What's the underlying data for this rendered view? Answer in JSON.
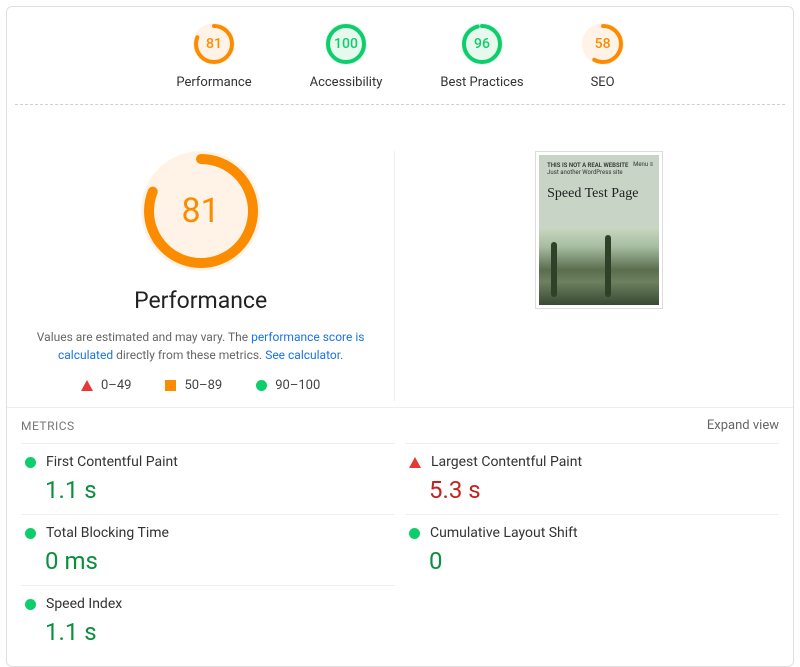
{
  "colors": {
    "avg": "#fb8c00",
    "good": "#0cce6b",
    "bad": "#e53935",
    "avg_fill": "#fef3e6",
    "good_fill": "#e7f8ed"
  },
  "top": [
    {
      "score": 81,
      "label": "Performance",
      "status": "avg"
    },
    {
      "score": 100,
      "label": "Accessibility",
      "status": "good"
    },
    {
      "score": 96,
      "label": "Best Practices",
      "status": "good"
    },
    {
      "score": 58,
      "label": "SEO",
      "status": "avg"
    }
  ],
  "big": {
    "score": 81,
    "label": "Performance",
    "status": "avg"
  },
  "disclaimer": {
    "pre": "Values are estimated and may vary. The ",
    "link1": "performance score is calculated",
    "mid": " directly from these metrics. ",
    "link2": "See calculator"
  },
  "legend": {
    "bad": "0–49",
    "avg": "50–89",
    "good": "90–100"
  },
  "screenshot": {
    "tag": "THIS IS NOT A REAL WEBSITE",
    "sub": "Just another WordPress site",
    "menu": "Menu ≡",
    "title": "Speed Test Page"
  },
  "metrics_header": {
    "label": "METRICS",
    "expand": "Expand view"
  },
  "metrics": [
    {
      "name": "First Contentful Paint",
      "value": "1.1 s",
      "status": "good"
    },
    {
      "name": "Largest Contentful Paint",
      "value": "5.3 s",
      "status": "bad"
    },
    {
      "name": "Total Blocking Time",
      "value": "0 ms",
      "status": "good"
    },
    {
      "name": "Cumulative Layout Shift",
      "value": "0",
      "status": "good"
    },
    {
      "name": "Speed Index",
      "value": "1.1 s",
      "status": "good"
    }
  ]
}
